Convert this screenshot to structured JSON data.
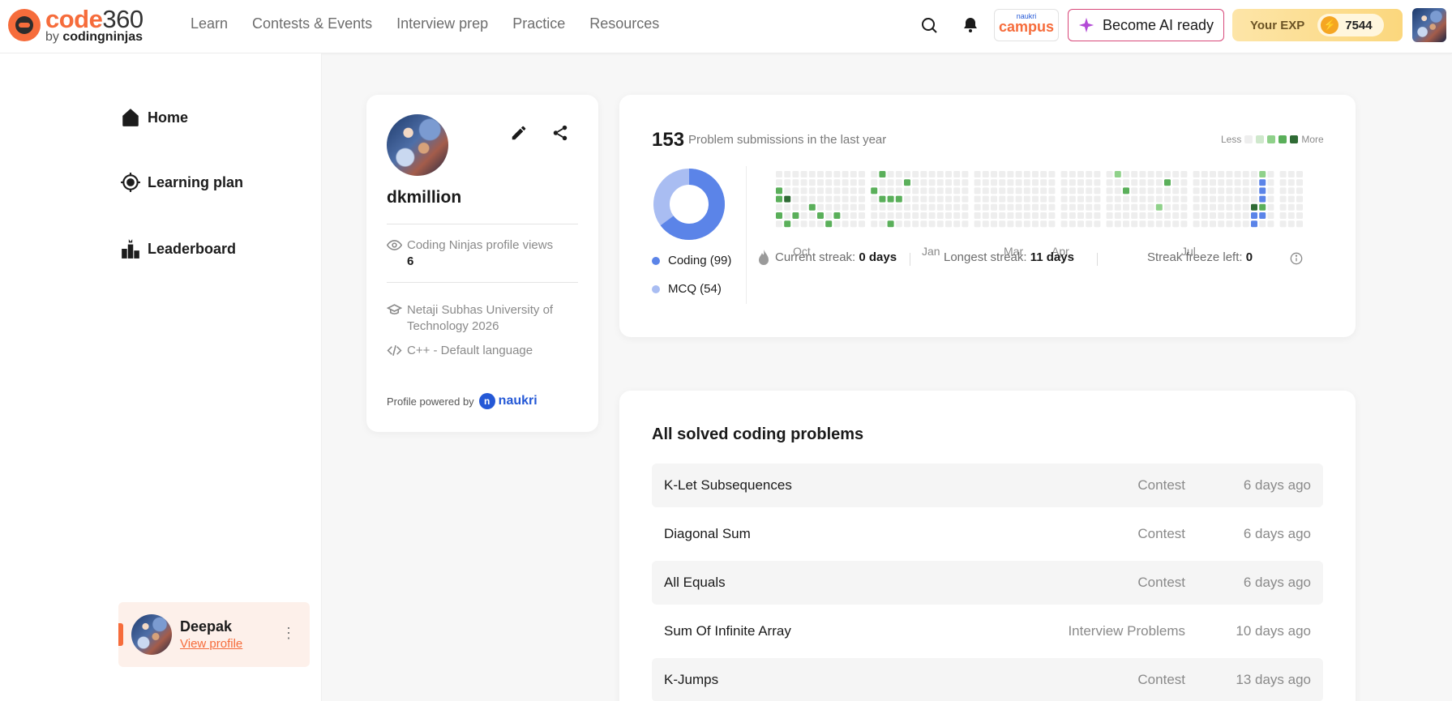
{
  "header": {
    "logo_code": "code",
    "logo_num": "360",
    "logo_by": "by",
    "logo_brand": "codingninjas",
    "nav": [
      "Learn",
      "Contests & Events",
      "Interview prep",
      "Practice",
      "Resources"
    ],
    "campus_top": "naukri",
    "campus_label": "campus",
    "ai_button": "Become AI ready",
    "exp_label": "Your EXP",
    "exp_value": "7544"
  },
  "sidebar": {
    "items": [
      {
        "label": "Home",
        "icon": "home-icon"
      },
      {
        "label": "Learning plan",
        "icon": "target-icon"
      },
      {
        "label": "Leaderboard",
        "icon": "leaderboard-icon"
      }
    ],
    "user": {
      "name": "Deepak",
      "link": "View profile"
    }
  },
  "profile": {
    "username": "dkmillion",
    "views_label": "Coding Ninjas profile views",
    "views_value": "6",
    "education": "Netaji Subhas University of Technology 2026",
    "language": "C++ - Default language",
    "powered_by": "Profile powered by",
    "powered_brand": "naukri"
  },
  "stats": {
    "submissions_count": "153",
    "submissions_label": "Problem submissions in the last year",
    "legend_less": "Less",
    "legend_more": "More",
    "coding_label": "Coding (99)",
    "mcq_label": "MCQ (54)",
    "coding_value": 99,
    "mcq_value": 54,
    "coding_color": "#5b84e8",
    "mcq_color": "#a9bdf2",
    "months": [
      "Oct",
      "Jan",
      "Mar",
      "Apr",
      "Jul"
    ],
    "current_streak_label": "Current streak:",
    "current_streak_value": "0 days",
    "longest_streak_label": "Longest streak:",
    "longest_streak_value": "11 days",
    "freeze_label": "Streak freeze left:",
    "freeze_value": "0"
  },
  "solved": {
    "title": "All solved coding problems",
    "rows": [
      {
        "name": "K-Let Subsequences",
        "type": "Contest",
        "time": "6 days ago"
      },
      {
        "name": "Diagonal Sum",
        "type": "Contest",
        "time": "6 days ago"
      },
      {
        "name": "All Equals",
        "type": "Contest",
        "time": "6 days ago"
      },
      {
        "name": "Sum Of Infinite Array",
        "type": "Interview Problems",
        "time": "10 days ago"
      },
      {
        "name": "K-Jumps",
        "type": "Contest",
        "time": "13 days ago"
      }
    ]
  },
  "colors": {
    "brand": "#f66c3b",
    "naukri_blue": "#2458d6",
    "heat_levels": [
      "#eeeeee",
      "#cfe8cc",
      "#8fd18a",
      "#5aaf5a",
      "#2f6b35"
    ]
  }
}
